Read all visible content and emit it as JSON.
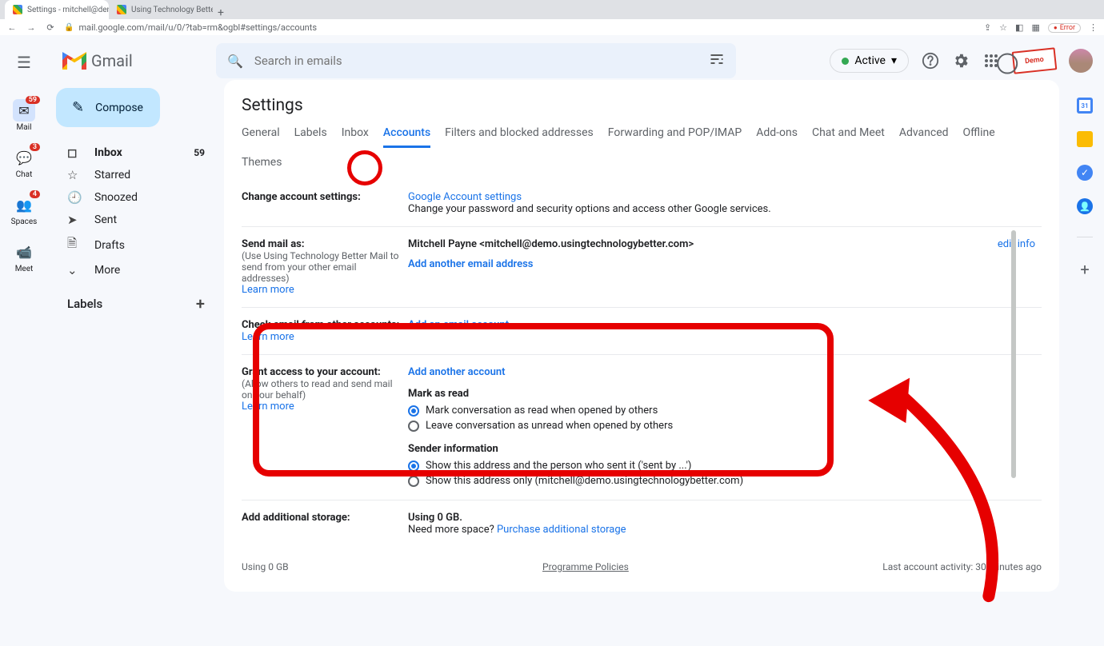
{
  "browser": {
    "tabs": [
      {
        "title": "Settings - mitchell@demo.usi",
        "active": true
      },
      {
        "title": "Using Technology Better Mai",
        "active": false
      }
    ],
    "url": "mail.google.com/mail/u/0/?tab=rm&ogbl#settings/accounts",
    "error_chip": "Error"
  },
  "header": {
    "product": "Gmail",
    "search_placeholder": "Search in emails",
    "active_label": "Active"
  },
  "left_rail": {
    "mail": {
      "label": "Mail",
      "badge": "59"
    },
    "chat": {
      "label": "Chat",
      "badge": "3"
    },
    "spaces": {
      "label": "Spaces",
      "badge": "4"
    },
    "meet": {
      "label": "Meet"
    }
  },
  "nav": {
    "compose": "Compose",
    "inbox": {
      "label": "Inbox",
      "count": "59"
    },
    "starred": "Starred",
    "snoozed": "Snoozed",
    "sent": "Sent",
    "drafts": "Drafts",
    "more": "More",
    "labels_header": "Labels"
  },
  "settings": {
    "title": "Settings",
    "tabs": [
      "General",
      "Labels",
      "Inbox",
      "Accounts",
      "Filters and blocked addresses",
      "Forwarding and POP/IMAP",
      "Add-ons",
      "Chat and Meet",
      "Advanced",
      "Offline"
    ],
    "themes": "Themes",
    "active_tab": "Accounts",
    "change_account": {
      "label": "Change account settings:",
      "link": "Google Account settings",
      "desc": "Change your password and security options and access other Google services."
    },
    "send_mail": {
      "label": "Send mail as:",
      "sub": "(Use Using Technology Better Mail to send from your other email addresses)",
      "learn": "Learn more",
      "identity": "Mitchell Payne <mitchell@demo.usingtechnologybetter.com>",
      "add_link": "Add another email address",
      "edit": "edit info"
    },
    "check_mail": {
      "label": "Check email from other accounts:",
      "learn": "Learn more",
      "add_link": "Add an email account"
    },
    "grant_access": {
      "label": "Grant access to your account:",
      "sub": "(Allow others to read and send mail on your behalf)",
      "learn": "Learn more",
      "add_link": "Add another account",
      "mark_heading": "Mark as read",
      "mark_opt1": "Mark conversation as read when opened by others",
      "mark_opt2": "Leave conversation as unread when opened by others",
      "sender_heading": "Sender information",
      "sender_opt1": "Show this address and the person who sent it ('sent by ...')",
      "sender_opt2": "Show this address only (mitchell@demo.usingtechnologybetter.com)"
    },
    "storage": {
      "label": "Add additional storage:",
      "using": "Using 0 GB.",
      "need": "Need more space? ",
      "purchase": "Purchase additional storage"
    },
    "footer": {
      "left": "Using 0 GB",
      "center": "Programme Policies",
      "right": "Last account activity: 30 minutes ago"
    }
  },
  "demo_stamp": "Demo"
}
